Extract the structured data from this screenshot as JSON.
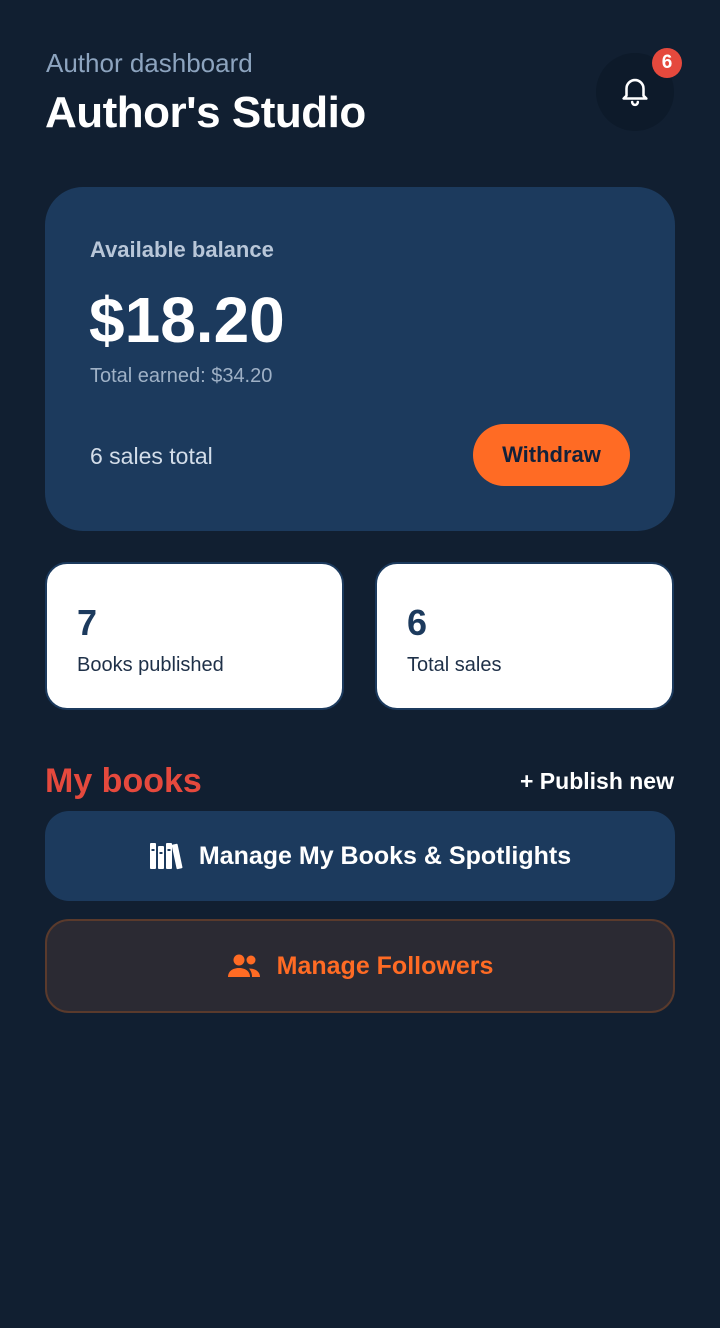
{
  "header": {
    "subtitle": "Author dashboard",
    "title": "Author's Studio",
    "notifications": {
      "icon": "bell-icon",
      "count": "6"
    }
  },
  "balance": {
    "label": "Available balance",
    "amount": "$18.20",
    "total_earned": "Total earned: $34.20",
    "sales_total": "6 sales total",
    "withdraw_label": "Withdraw"
  },
  "stats": [
    {
      "value": "7",
      "label": "Books published"
    },
    {
      "value": "6",
      "label": "Total sales"
    }
  ],
  "books_section": {
    "title": "My books",
    "publish_label": "+ Publish new",
    "manage_books_label": "Manage My Books & Spotlights",
    "manage_books_icon": "books-icon",
    "manage_followers_label": "Manage Followers",
    "manage_followers_icon": "people-icon"
  },
  "colors": {
    "background": "#111f31",
    "card": "#1c3a5d",
    "accent": "#ff6b24",
    "section_title": "#e5493d",
    "badge": "#e5493d"
  }
}
